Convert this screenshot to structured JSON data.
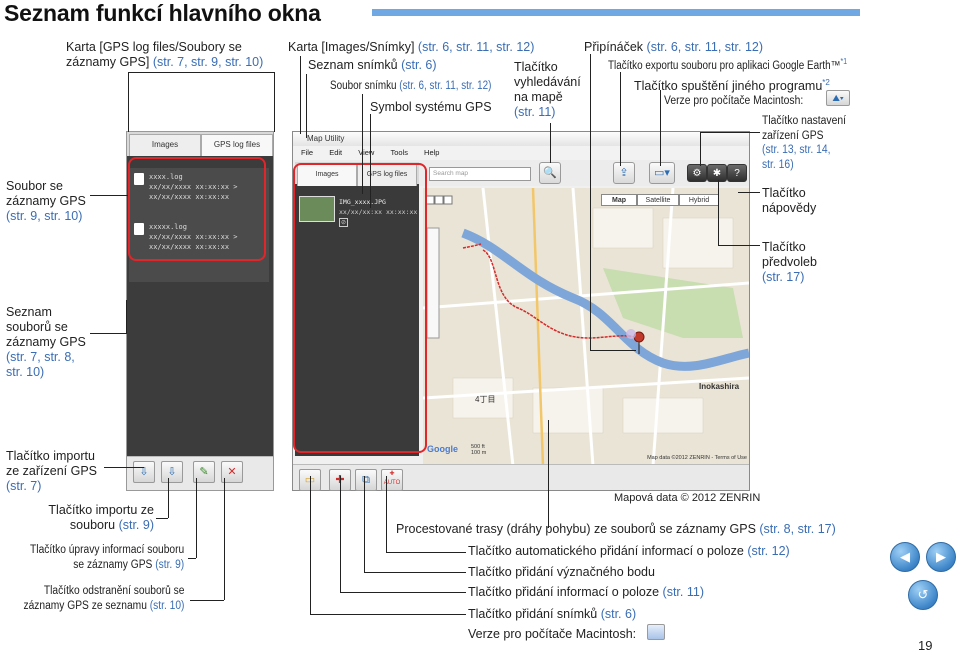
{
  "header": {
    "title": "Seznam funkcí hlavního okna"
  },
  "callouts": {
    "gps_tab": [
      "Karta [GPS log files/Soubory se",
      "záznamy GPS] ",
      "(str. 7, str. 9, str. 10)"
    ],
    "images_tab": [
      "Karta [Images/Snímky] ",
      "(str. 6, str. 11, str. 12)"
    ],
    "image_list": [
      "Seznam snímků ",
      "(str. 6)"
    ],
    "image_file": [
      "Soubor snímku ",
      "(str. 6, str. 11, str. 12)"
    ],
    "gps_symbol": "Symbol systému GPS",
    "map_search": [
      "Tlačítko",
      "vyhledávání",
      "na mapě",
      "(str. 11)"
    ],
    "pin": [
      "Připínáček ",
      "(str. 6, str. 11, str. 12)"
    ],
    "google_earth": [
      "Tlačítko exportu souboru pro aplikaci Google Earth™",
      "*1"
    ],
    "other_program": [
      "Tlačítko spuštění jiného programu",
      "*2"
    ],
    "mac_version": "Verze pro počítače Macintosh:",
    "device_settings": [
      "Tlačítko nastavení",
      "zařízení GPS",
      "(str. 13, str. 14,",
      "str. 16)"
    ],
    "help": [
      "Tlačítko",
      "nápovědy"
    ],
    "preferences": [
      "Tlačítko",
      "předvoleb",
      "(str. 17)"
    ],
    "gps_file": [
      "Soubor se",
      "záznamy GPS",
      "(str. 9, str. 10)"
    ],
    "gps_file_list": [
      "Seznam",
      "souborů se",
      "záznamy GPS",
      "(str. 7, str. 8,",
      "str. 10)"
    ],
    "import_device": [
      "Tlačítko importu",
      "ze zařízení GPS",
      "(str. 7)"
    ],
    "import_file": [
      "Tlačítko importu ze",
      "souboru ",
      "(str. 9)"
    ],
    "edit_info": [
      "Tlačítko úpravy informací souboru",
      "se záznamy GPS ",
      "(str. 9)"
    ],
    "remove_files": [
      "Tlačítko odstranění souborů se",
      "záznamy GPS ze seznamu ",
      "(str. 10)"
    ],
    "map_data": "Mapová data © 2012 ZENRIN",
    "tracks": [
      "Procestované trasy (dráhy pohybu) ze souborů se záznamy GPS ",
      "(str. 8, str. 17)"
    ],
    "auto_location": [
      "Tlačítko automatického přidání informací o poloze ",
      "(str. 12)"
    ],
    "add_waypoint": "Tlačítko přidání význačného bodu",
    "add_location": [
      "Tlačítko přidání informací o poloze ",
      "(str. 11)"
    ],
    "add_image": [
      "Tlačítko přidání snímků ",
      "(str. 6)"
    ],
    "mac_version_bottom": "Verze pro počítače Macintosh:"
  },
  "left_panel": {
    "tabs": [
      "Images",
      "GPS log files"
    ],
    "files": [
      {
        "name": "xxxx.log",
        "lines": [
          "xx/xx/xxxx xx:xx:xx >",
          "xx/xx/xxxx xx:xx:xx"
        ]
      },
      {
        "name": "xxxxx.log",
        "lines": [
          "xx/xx/xxxx xx:xx:xx >",
          "xx/xx/xxxx xx:xx:xx"
        ]
      }
    ]
  },
  "app": {
    "title": "Map Utility",
    "menu": [
      "File",
      "Edit",
      "View",
      "Tools",
      "Help"
    ],
    "tabs": [
      "Images",
      "GPS log files"
    ],
    "search_placeholder": "Search map",
    "image_name": "IMG_xxxx.JPG",
    "image_date": "xx/xx/xx:xx xx:xx:xx",
    "map_types": [
      "Map",
      "Satellite",
      "Hybrid"
    ],
    "map_label": "Inokashira",
    "map_block": "4丁目",
    "scale_ft": "500 ft",
    "scale_m": "100 m",
    "copyright": "Map data ©2012 ZENRIN - Terms of Use",
    "auto_label": "AUTO"
  },
  "page_number": "19",
  "colors": {
    "accent_blue": "#3a6db4",
    "highlight_red": "#e0262a",
    "route_red": "#d42a2a",
    "river_blue": "#7fa6d8"
  }
}
